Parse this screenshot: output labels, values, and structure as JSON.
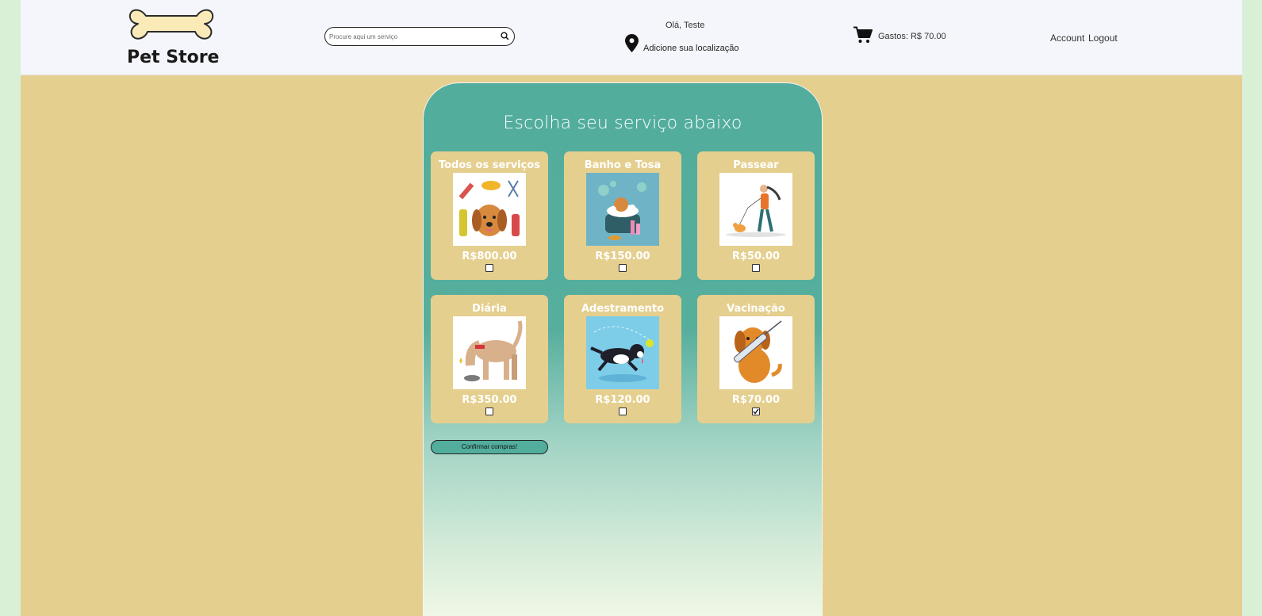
{
  "brand": {
    "name": "Pet Store"
  },
  "search": {
    "placeholder": "Procure aqui um serviço"
  },
  "user": {
    "greeting": "Olá, Teste",
    "location_prompt": "Adicione sua localização"
  },
  "cart": {
    "spent_label": "Gastos: R$ 70.00"
  },
  "nav": {
    "account": "Account",
    "logout": "Logout"
  },
  "panel": {
    "title": "Escolha seu serviço abaixo",
    "services": [
      {
        "name": "Todos os serviços",
        "price": "R$800.00",
        "checked": false,
        "image": "grooming-products-dog"
      },
      {
        "name": "Banho e Tosa",
        "price": "R$150.00",
        "checked": false,
        "image": "dog-bath"
      },
      {
        "name": "Passear",
        "price": "R$50.00",
        "checked": false,
        "image": "woman-walking-dog"
      },
      {
        "name": "Diária",
        "price": "R$350.00",
        "checked": false,
        "image": "dog-eating"
      },
      {
        "name": "Adestramento",
        "price": "R$120.00",
        "checked": false,
        "image": "dog-running-ball"
      },
      {
        "name": "Vacinação",
        "price": "R$70.00",
        "checked": true,
        "image": "dog-vaccine"
      }
    ],
    "confirm_label": "Confirmar compras!"
  },
  "colors": {
    "page_bg": "#d9f0d7",
    "content_bg": "#e5cf8e",
    "header_bg": "#f5f6fb",
    "teal": "#52ad9c"
  }
}
